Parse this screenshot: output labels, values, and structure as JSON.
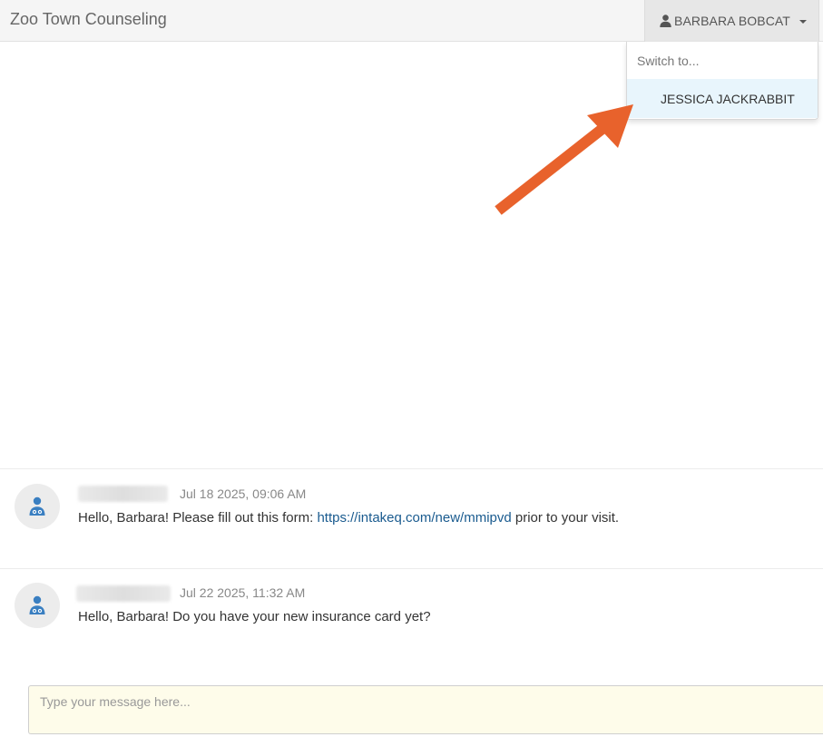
{
  "app": {
    "title": "Zoo Town Counseling"
  },
  "user_menu": {
    "current_user": "BARBARA BOBCAT",
    "user_icon": "person-icon",
    "caret_icon": "caret-down-icon",
    "dropdown": {
      "header": "Switch to...",
      "items": [
        {
          "label": "JESSICA JACKRABBIT"
        }
      ]
    }
  },
  "annotation": {
    "arrow_color": "#e8622c"
  },
  "messages": [
    {
      "avatar_icon": "doctor-icon",
      "timestamp": "Jul 18 2025, 09:06 AM",
      "text_before": "Hello, Barbara! Please fill out this form: ",
      "link": "https://intakeq.com/new/mmipvd",
      "text_after": " prior to your visit."
    },
    {
      "avatar_icon": "doctor-icon",
      "timestamp": "Jul 22 2025, 11:32 AM",
      "text": "Hello, Barbara! Do you have your new insurance card yet?"
    }
  ],
  "composer": {
    "placeholder": "Type your message here...",
    "value": ""
  },
  "colors": {
    "link": "#1a5b8f",
    "avatar_icon": "#3a7fc1",
    "composer_bg": "#fefcea",
    "dropdown_highlight": "#e8f5fc"
  }
}
